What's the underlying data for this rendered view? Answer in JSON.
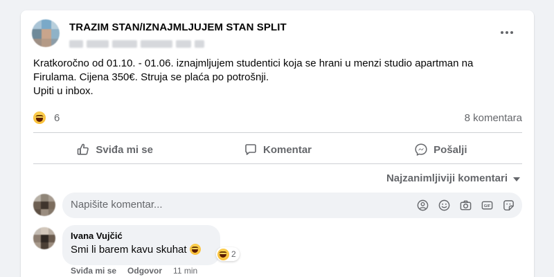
{
  "post": {
    "group_title": "TRAZIM STAN/IZNAJMLJUJEM STAN SPLIT",
    "body_lines": [
      "Kratkoročno od 01.10. - 01.06. iznajmljujem studentici koja se hrani u menzi studio apartman na",
      "Firulama. Cijena 350€. Struja se plaća po potrošnji.",
      "Upiti u inbox."
    ],
    "reaction_icon": "laughing-emoji-icon",
    "reaction_count": "6",
    "comment_count": "8 komentara"
  },
  "actions": {
    "like_label": "Sviđa mi se",
    "comment_label": "Komentar",
    "send_label": "Pošalji"
  },
  "comments_sort": {
    "label": "Najzanimljiviji komentari"
  },
  "composer": {
    "placeholder": "Napišite komentar...",
    "icons": [
      "avatar-sticker-icon",
      "emoji-icon",
      "camera-icon",
      "gif-icon",
      "sticker-icon"
    ]
  },
  "comment": {
    "author": "Ivana Vujčić",
    "text": "Smi li barem kavu skuhat",
    "reaction_count": "2",
    "like_label": "Sviđa mi se",
    "reply_label": "Odgovor",
    "time": "11 min"
  },
  "colors": {
    "background": "#f0f2f5",
    "card": "#ffffff",
    "secondary_text": "#65676b",
    "primary_text": "#050505",
    "divider": "#ced0d4"
  }
}
